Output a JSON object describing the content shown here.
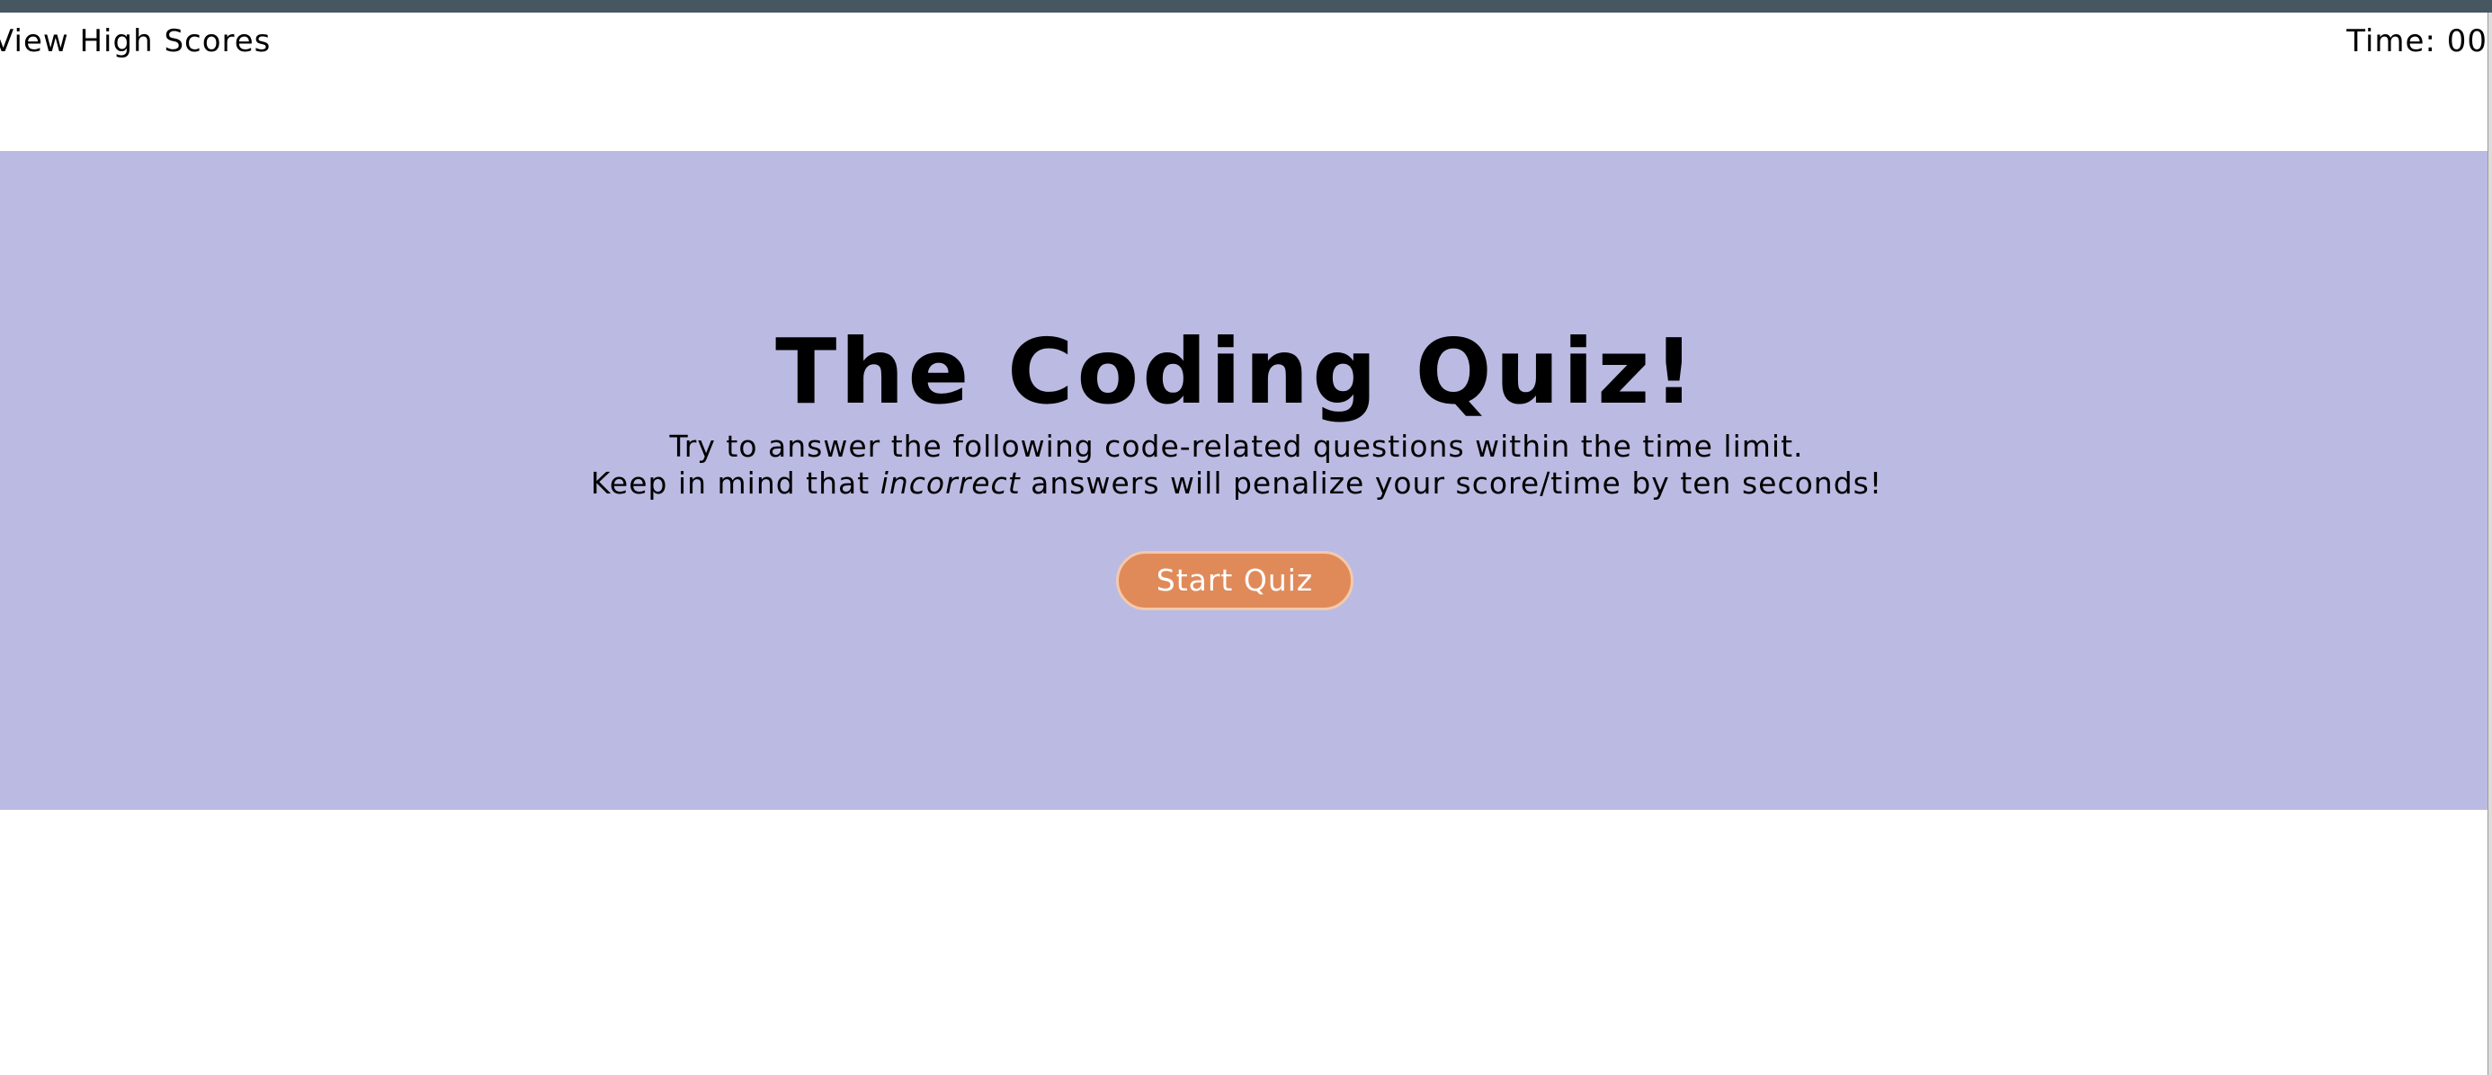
{
  "header": {
    "high_scores_link": "View High Scores",
    "timer_label": "Time: ",
    "timer_value": "00"
  },
  "hero": {
    "title": "The Coding Quiz!",
    "line1": "Try to answer the following code-related questions within the time limit.",
    "line2_before": "Keep in mind that ",
    "line2_emphasis": "incorrect",
    "line2_after": " answers will penalize your score/time by ten seconds!",
    "start_button": "Start Quiz"
  },
  "colors": {
    "hero_background": "#bbbae2",
    "button_background": "#e08a5a",
    "button_border": "#f3c9ad",
    "top_strip": "#465762"
  }
}
